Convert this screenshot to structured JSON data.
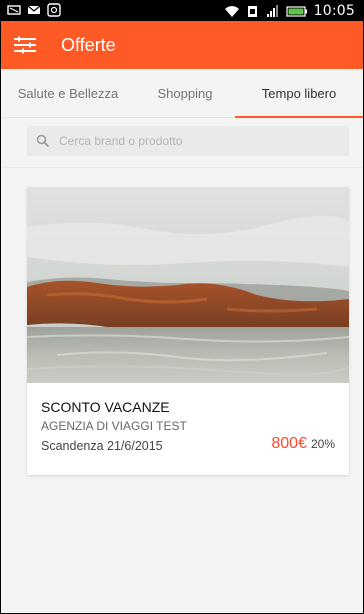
{
  "status_bar": {
    "time": "10:05",
    "left_icons": [
      "notification-icon",
      "message-icon",
      "app-icon"
    ],
    "right_icons": [
      "wifi-icon",
      "sim-icon",
      "signal-icon",
      "battery-icon"
    ]
  },
  "app_bar": {
    "title": "Offerte",
    "menu_icon": "hamburger-menu-icon"
  },
  "tabs": [
    {
      "label": "Salute e Bellezza",
      "active": false
    },
    {
      "label": "Shopping",
      "active": false
    },
    {
      "label": "Tempo libero",
      "active": true
    }
  ],
  "search": {
    "placeholder": "Cerca brand o prodotto",
    "value": ""
  },
  "offer": {
    "title": "SCONTO VACANZE",
    "agency": "AGENZIA DI VIAGGI TEST",
    "expiry": "Scandenza 21/6/2015",
    "price": "800€",
    "discount": "20%"
  },
  "colors": {
    "accent": "#ff5a26",
    "price": "#ff4a2b",
    "status_bar": "#000000"
  }
}
